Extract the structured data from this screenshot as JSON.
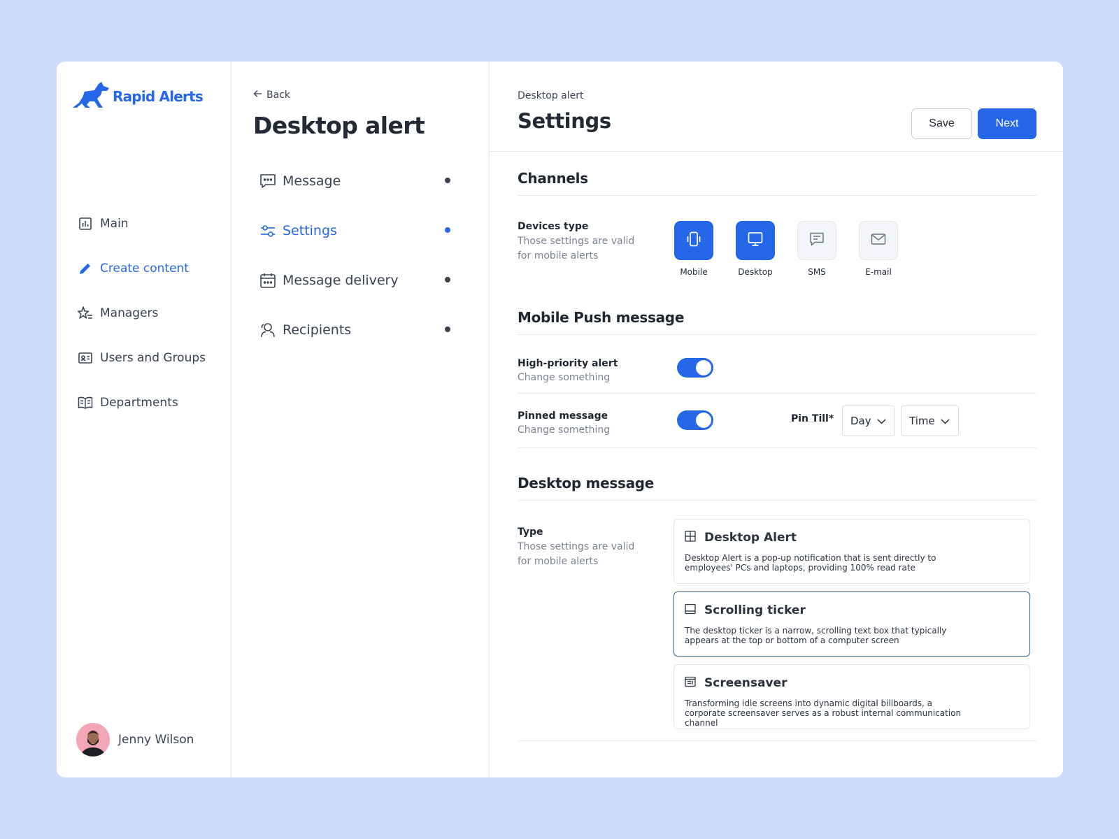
{
  "app": {
    "name": "Rapid Alerts"
  },
  "sidebar": {
    "items": [
      {
        "label": "Main",
        "icon": "chart-icon"
      },
      {
        "label": "Create content",
        "icon": "pencil-icon",
        "active": true
      },
      {
        "label": "Managers",
        "icon": "star-list-icon"
      },
      {
        "label": "Users and Groups",
        "icon": "id-card-icon"
      },
      {
        "label": "Departments",
        "icon": "book-icon"
      }
    ],
    "user": {
      "name": "Jenny Wilson"
    }
  },
  "middle": {
    "back_label": "Back",
    "title": "Desktop alert",
    "steps": [
      {
        "label": "Message",
        "icon": "chat-icon"
      },
      {
        "label": "Settings",
        "icon": "sliders-icon",
        "active": true
      },
      {
        "label": "Message delivery",
        "icon": "calendar-icon"
      },
      {
        "label": "Recipients",
        "icon": "users-icon"
      }
    ]
  },
  "main": {
    "breadcrumb": "Desktop alert",
    "title": "Settings",
    "save_label": "Save",
    "next_label": "Next",
    "channels": {
      "title": "Channels",
      "label": "Devices type",
      "desc": "Those settings are valid for mobile alerts",
      "devices": [
        {
          "label": "Mobile",
          "icon": "mobile-icon",
          "selected": true
        },
        {
          "label": "Desktop",
          "icon": "monitor-icon",
          "selected": true
        },
        {
          "label": "SMS",
          "icon": "message-icon",
          "selected": false
        },
        {
          "label": "E-mail",
          "icon": "mail-icon",
          "selected": false
        }
      ]
    },
    "push": {
      "title": "Mobile Push message",
      "rows": [
        {
          "label": "High-priority alert",
          "desc": "Change something",
          "enabled": true
        },
        {
          "label": "Pinned message",
          "desc": "Change something",
          "enabled": true
        }
      ],
      "pin_label": "Pin Till*",
      "day_value": "Day",
      "time_value": "Time"
    },
    "desktop": {
      "title": "Desktop message",
      "label": "Type",
      "desc": "Those settings are valid for mobile alerts",
      "types": [
        {
          "name": "Desktop Alert",
          "icon": "grid-icon",
          "desc": "Desktop Alert is a pop-up notification that is sent directly to employees' PCs and laptops, providing 100% read rate",
          "selected": false
        },
        {
          "name": "Scrolling ticker",
          "icon": "ticker-icon",
          "desc": "The desktop ticker is a narrow, scrolling text box that typically appears at the top or bottom of a computer screen",
          "selected": true
        },
        {
          "name": "Screensaver",
          "icon": "screensaver-icon",
          "desc": "Transforming idle screens into dynamic digital billboards, a corporate screensaver serves as a robust internal communication channel",
          "selected": false
        }
      ]
    }
  },
  "colors": {
    "accent": "#2567e8",
    "background": "#cddcfb",
    "text": "#2b3340"
  }
}
